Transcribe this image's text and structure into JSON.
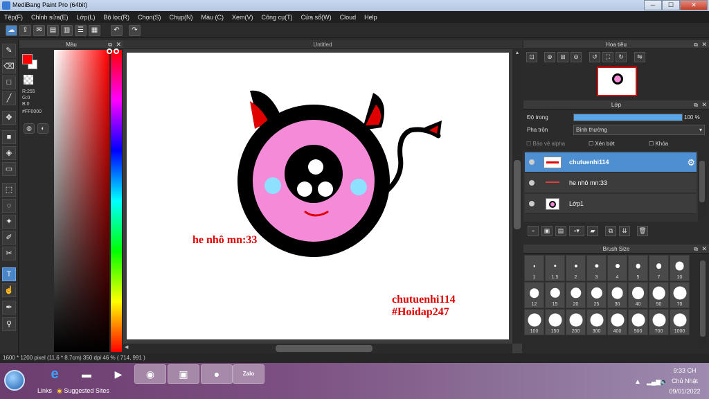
{
  "window": {
    "title": "MediBang Paint Pro (64bit)",
    "min_label": "─",
    "max_label": "☐",
    "close_label": "✕"
  },
  "menu": [
    "Tệp(F)",
    "Chỉnh sửa(E)",
    "Lớp(L)",
    "Bộ lọc(R)",
    "Chọn(S)",
    "Chụp(N)",
    "Màu (C)",
    "Xem(V)",
    "Công cụ(T)",
    "Cửa sổ(W)",
    "Cloud",
    "Help"
  ],
  "color_panel": {
    "title": "Màu",
    "r": "R:255",
    "g": "G:0",
    "b": "B:0",
    "hex": "#FF0000",
    "primary_color": "#ff0000",
    "secondary_color": "#ffffff"
  },
  "document": {
    "tab_title": "Untitled"
  },
  "canvas_text": {
    "label1": "he nhô mn:33",
    "label2_line1": "chutuenhi114",
    "label2_line2": "#Hoidap247"
  },
  "navigator": {
    "title": "Hoa tiêu"
  },
  "layers": {
    "title": "Lớp",
    "opacity_label": "Độ trong",
    "opacity_value": "100 %",
    "opacity_fraction": 1.0,
    "blend_label": "Pha trộn",
    "blend_value": "Bình thường",
    "protect_alpha": "Bảo vệ alpha",
    "clipping": "Xén bớt",
    "lock": "Khóa",
    "items": [
      {
        "name": "chutuenhi114",
        "selected": true
      },
      {
        "name": "he nhô mn:33",
        "selected": false
      },
      {
        "name": "Lớp1",
        "selected": false
      }
    ]
  },
  "brush_size": {
    "title": "Brush Size",
    "sizes": [
      "1",
      "1.5",
      "2",
      "3",
      "4",
      "5",
      "7",
      "10",
      "12",
      "15",
      "20",
      "25",
      "30",
      "40",
      "50",
      "70",
      "100",
      "150",
      "200",
      "300",
      "400",
      "500",
      "700",
      "1000"
    ]
  },
  "status": {
    "text": "1600 * 1200 pixel   (11.6 * 8.7cm)   350 dpi   46 %   ( 714, 991 )"
  },
  "taskbar": {
    "links_label": "Links",
    "suggested_label": "Suggested Sites",
    "time": "9:33 CH",
    "day": "Chủ Nhật",
    "date": "09/01/2022",
    "zalo_label": "Zalo"
  },
  "colors": {
    "accent": "#4d8fd0",
    "canvas_bg": "#ffffff",
    "pink": "#f48ad8",
    "text_red": "#e00000"
  }
}
